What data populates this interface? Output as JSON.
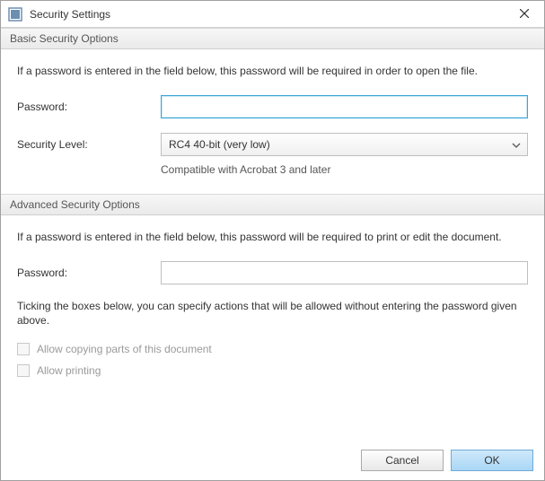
{
  "window": {
    "title": "Security Settings"
  },
  "basic": {
    "header": "Basic Security Options",
    "desc": "If a password is entered in the field below, this password will be required in order to open the file.",
    "password_label": "Password:",
    "password_value": "",
    "password_placeholder": "",
    "security_level_label": "Security Level:",
    "security_level_value": "RC4 40-bit (very low)",
    "compat_hint": "Compatible with Acrobat 3 and later"
  },
  "advanced": {
    "header": "Advanced Security Options",
    "desc": "If a password is entered in the field below, this password will be required to print or edit the document.",
    "password_label": "Password:",
    "password_value": "",
    "password_placeholder": "",
    "tick_desc": "Ticking the boxes below, you can specify actions that will be allowed without entering the password given above.",
    "allow_copy_label": "Allow copying parts of this document",
    "allow_copy_checked": false,
    "allow_copy_enabled": false,
    "allow_print_label": "Allow printing",
    "allow_print_checked": false,
    "allow_print_enabled": false
  },
  "buttons": {
    "cancel": "Cancel",
    "ok": "OK"
  }
}
